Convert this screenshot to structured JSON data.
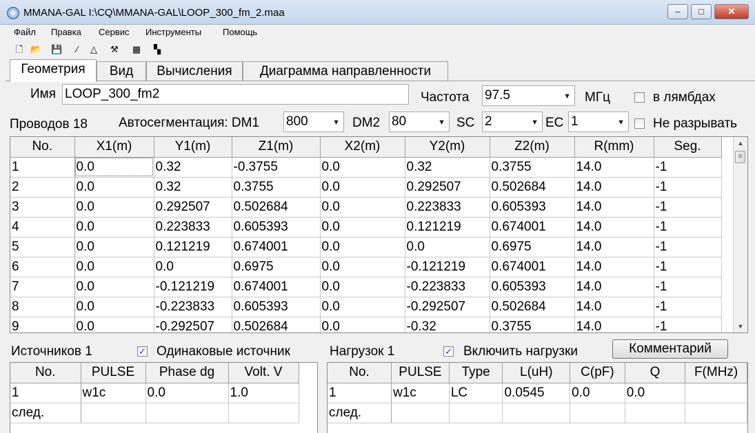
{
  "window": {
    "title": "MMANA-GAL I:\\CQ\\MMANA-GAL\\LOOP_300_fm_2.maa",
    "minimize": "‒",
    "maximize": "□",
    "close": "✕"
  },
  "menu": [
    "Файл",
    "Правка",
    "Сервис",
    "Инструменты",
    "Помощь"
  ],
  "toolbar_icons": [
    {
      "name": "new-file-icon",
      "glyph": "🗋"
    },
    {
      "name": "open-folder-icon",
      "glyph": "📂"
    },
    {
      "name": "save-icon",
      "glyph": "💾"
    },
    {
      "name": "wire-line-icon",
      "glyph": "∕"
    },
    {
      "name": "triangle-icon",
      "glyph": "△"
    },
    {
      "name": "tools-icon",
      "glyph": "⚒"
    },
    {
      "name": "calculator-icon",
      "glyph": "▦"
    },
    {
      "name": "plugin-icon",
      "glyph": "▚"
    }
  ],
  "tabs": [
    "Геометрия",
    "Вид",
    "Вычисления",
    "Диаграмма направленности"
  ],
  "geometry": {
    "name_label": "Имя",
    "name_value": "LOOP_300_fm2",
    "freq_label": "Частота",
    "freq_value": "97.5",
    "freq_unit": "МГц",
    "in_lambda_label": "в лямбдах",
    "wires_label": "Проводов 18",
    "autoseg_label": "Автосегментация: DM1",
    "dm1_value": "800",
    "dm2_label": "DM2",
    "dm2_value": "80",
    "sc_label": "SC",
    "sc_value": "2",
    "ec_label": "EC",
    "ec_value": "1",
    "no_break_label": "Не разрывать"
  },
  "wires_table": {
    "headers": [
      "No.",
      "X1(m)",
      "Y1(m)",
      "Z1(m)",
      "X2(m)",
      "Y2(m)",
      "Z2(m)",
      "R(mm)",
      "Seg."
    ],
    "rows": [
      [
        "1",
        "0.0",
        "0.32",
        "-0.3755",
        "0.0",
        "0.32",
        "0.3755",
        "14.0",
        "-1"
      ],
      [
        "2",
        "0.0",
        "0.32",
        "0.3755",
        "0.0",
        "0.292507",
        "0.502684",
        "14.0",
        "-1"
      ],
      [
        "3",
        "0.0",
        "0.292507",
        "0.502684",
        "0.0",
        "0.223833",
        "0.605393",
        "14.0",
        "-1"
      ],
      [
        "4",
        "0.0",
        "0.223833",
        "0.605393",
        "0.0",
        "0.121219",
        "0.674001",
        "14.0",
        "-1"
      ],
      [
        "5",
        "0.0",
        "0.121219",
        "0.674001",
        "0.0",
        "0.0",
        "0.6975",
        "14.0",
        "-1"
      ],
      [
        "6",
        "0.0",
        "0.0",
        "0.6975",
        "0.0",
        "-0.121219",
        "0.674001",
        "14.0",
        "-1"
      ],
      [
        "7",
        "0.0",
        "-0.121219",
        "0.674001",
        "0.0",
        "-0.223833",
        "0.605393",
        "14.0",
        "-1"
      ],
      [
        "8",
        "0.0",
        "-0.223833",
        "0.605393",
        "0.0",
        "-0.292507",
        "0.502684",
        "14.0",
        "-1"
      ],
      [
        "9",
        "0.0",
        "-0.292507",
        "0.502684",
        "0.0",
        "-0.32",
        "0.3755",
        "14.0",
        "-1"
      ]
    ]
  },
  "sources": {
    "label": "Источников 1",
    "same_label": "Одинаковые источник",
    "same_checked": true,
    "headers": [
      "No.",
      "PULSE",
      "Phase dg",
      "Volt. V"
    ],
    "rows": [
      [
        "1",
        "w1c",
        "0.0",
        "1.0"
      ]
    ],
    "next_label": "след."
  },
  "loads": {
    "label": "Нагрузок 1",
    "enable_label": "Включить нагрузки",
    "enable_checked": true,
    "comment_button": "Комментарий",
    "headers": [
      "No.",
      "PULSE",
      "Type",
      "L(uH)",
      "C(pF)",
      "Q",
      "F(MHz)"
    ],
    "rows": [
      [
        "1",
        "w1c",
        "LC",
        "0.0545",
        "0.0",
        "0.0",
        ""
      ]
    ],
    "next_label": "след."
  }
}
